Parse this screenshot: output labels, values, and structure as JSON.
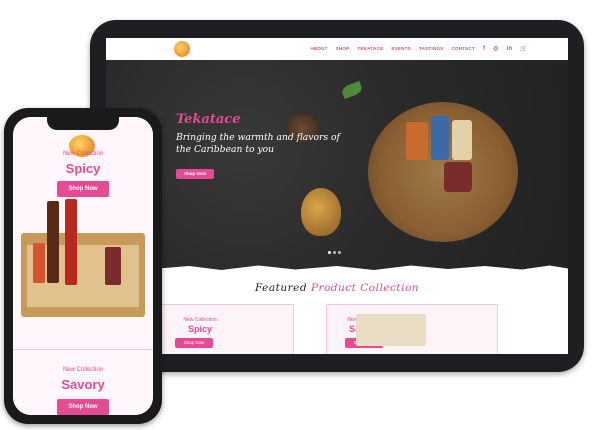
{
  "tablet": {
    "nav": [
      "ABOUT",
      "SHOP",
      "TEKATACE",
      "EVENTS",
      "TASTINGS",
      "CONTACT"
    ],
    "social": [
      "f",
      "◎",
      "in",
      "🛒"
    ],
    "hero": {
      "brand": "Tekatace",
      "tagline": "Bringing the warmth and flavors of the Caribbean to you",
      "button": "Shop Now"
    },
    "featured": {
      "title_1": "Featured",
      "title_2": "Product Collection"
    },
    "cards": [
      {
        "label": "New Collection",
        "title": "Spicy",
        "button": "Shop Now"
      },
      {
        "label": "New Collection",
        "title": "Savory",
        "button": "Shop Now"
      }
    ]
  },
  "phone": {
    "top_label": "New Collection",
    "top_title": "Spicy",
    "top_button": "Shop Now",
    "bottom_label": "New Collection",
    "bottom_title": "Savory",
    "bottom_button": "Shop Now"
  },
  "colors": {
    "accent": "#e44b93",
    "hero_bg": "#2b2a2a"
  }
}
